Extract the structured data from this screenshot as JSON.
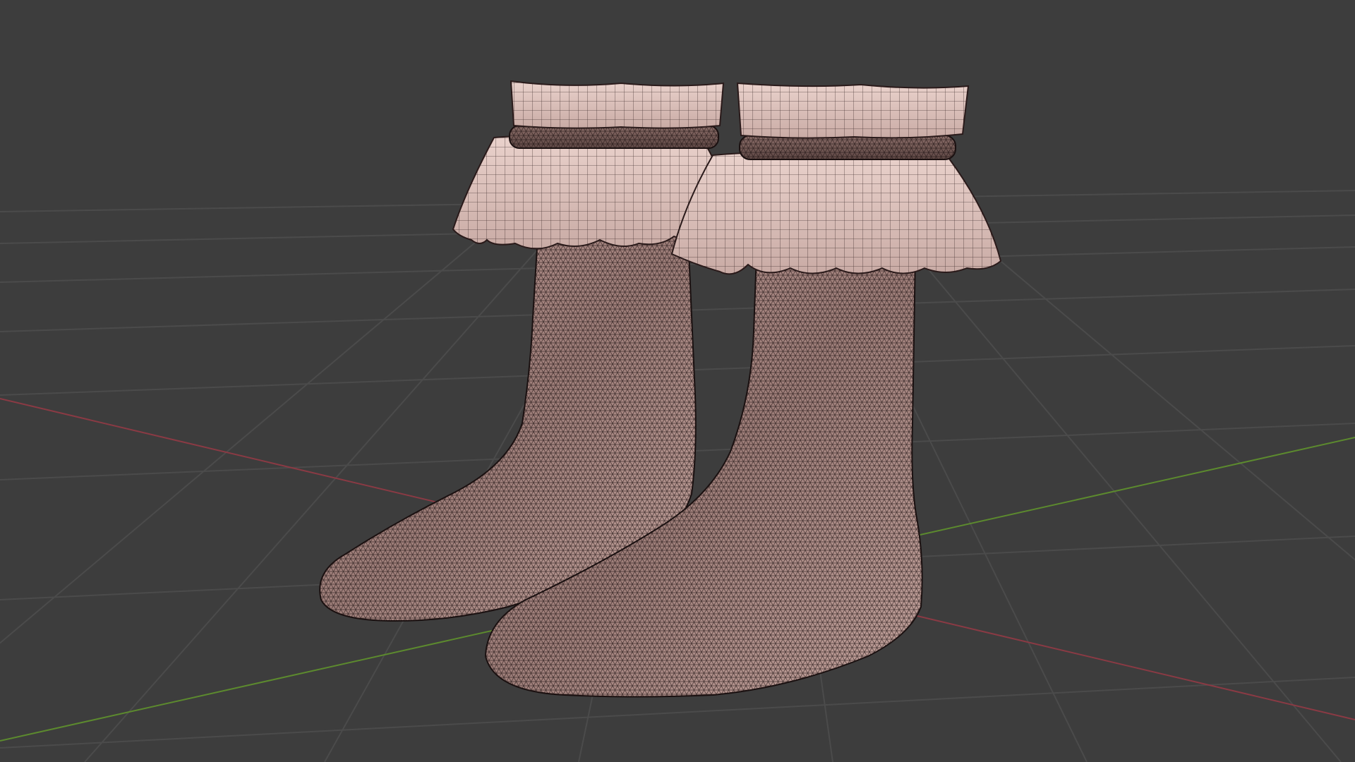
{
  "viewport": {
    "background": "#3d3d3d",
    "grid_line_color": "#4a4a4a",
    "x_axis_color": "#8a3a44",
    "y_axis_color": "#5c8a2e",
    "grid_visible": true
  },
  "model": {
    "shading": "wireframe-overlay",
    "skin_color": "#c7a6a0",
    "wire_color": "#1e1414",
    "ruffle_color": "#e2c6c0",
    "objects": [
      "left-sock",
      "right-sock"
    ]
  }
}
